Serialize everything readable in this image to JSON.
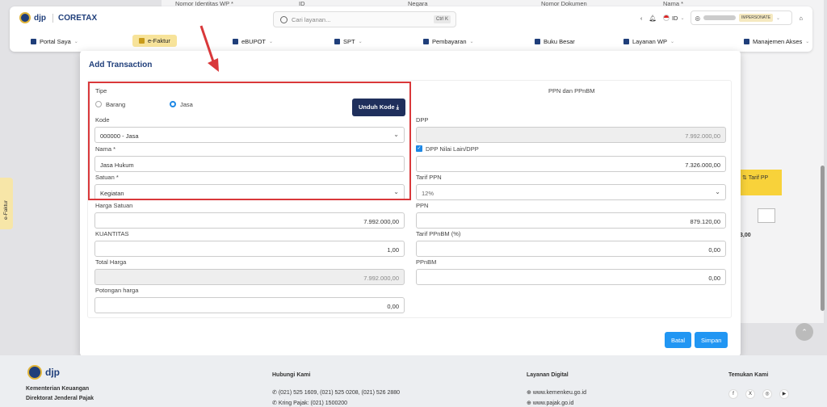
{
  "background": {
    "columns": [
      "Nomor Identitas WP *",
      "ID",
      "Negara",
      "Nomor Dokumen",
      "Nama *"
    ],
    "table_header": "Tarif PP",
    "table_value": "3,00"
  },
  "header": {
    "brand_djp": "djp",
    "brand_coretax": "CORETAX",
    "search_placeholder": "Cari layanan...",
    "search_kbd": "Ctrl K",
    "lang": "ID",
    "impersonate": "IMPERSONATE"
  },
  "menu": [
    {
      "label": "Portal Saya"
    },
    {
      "label": "e-Faktur"
    },
    {
      "label": "eBUPOT"
    },
    {
      "label": "SPT"
    },
    {
      "label": "Pembayaran"
    },
    {
      "label": "Buku Besar"
    },
    {
      "label": "Layanan WP"
    },
    {
      "label": "Manajemen Akses"
    }
  ],
  "side_tab": "e-Faktur",
  "modal": {
    "title": "Add Transaction",
    "tipe_label": "Tipe",
    "radio_barang": "Barang",
    "radio_jasa": "Jasa",
    "unduh_kode": "Unduh Kode",
    "kode_label": "Kode",
    "kode_value": "000000 - Jasa",
    "nama_label": "Nama *",
    "nama_value": "Jasa Hukum",
    "satuan_label": "Satuan *",
    "satuan_value": "Kegiatan",
    "harga_satuan_label": "Harga Satuan",
    "harga_satuan_value": "7.992.000,00",
    "kuantitas_label": "KUANTITAS",
    "kuantitas_value": "1,00",
    "total_harga_label": "Total Harga",
    "total_harga_value": "7.992.000,00",
    "potongan_label": "Potongan harga",
    "potongan_value": "0,00",
    "ppn_section": "PPN dan PPnBM",
    "dpp_label": "DPP",
    "dpp_value": "7.992.000,00",
    "dpp_nilai_lain_label": "DPP Nilai Lain/DPP",
    "dpp_nilai_lain_value": "7.326.000,00",
    "tarif_ppn_label": "Tarif PPN",
    "tarif_ppn_value": "12%",
    "ppn_label": "PPN",
    "ppn_value": "879.120,00",
    "tarif_ppnbm_label": "Tarif PPnBM (%)",
    "tarif_ppnbm_value": "0,00",
    "ppnbm_label": "PPnBM",
    "ppnbm_value": "0,00",
    "batal": "Batal",
    "simpan": "Simpan"
  },
  "footer": {
    "org1": "Kementerian Keuangan",
    "org2": "Direktorat Jenderal Pajak",
    "brand": "djp",
    "hubungi_title": "Hubungi Kami",
    "phone": "(021) 525 1609, (021) 525 0208, (021) 526 2880",
    "kring": "Kring Pajak: (021) 1500200",
    "layanan_title": "Layanan Digital",
    "web1": "www.kemenkeu.go.id",
    "web2": "www.pajak.go.id",
    "temukan_title": "Temukan Kami"
  },
  "colors": {
    "accent": "#2196f3",
    "navy": "#1f2f5c",
    "highlight": "#f7e39a",
    "annotation": "#d9383a"
  }
}
